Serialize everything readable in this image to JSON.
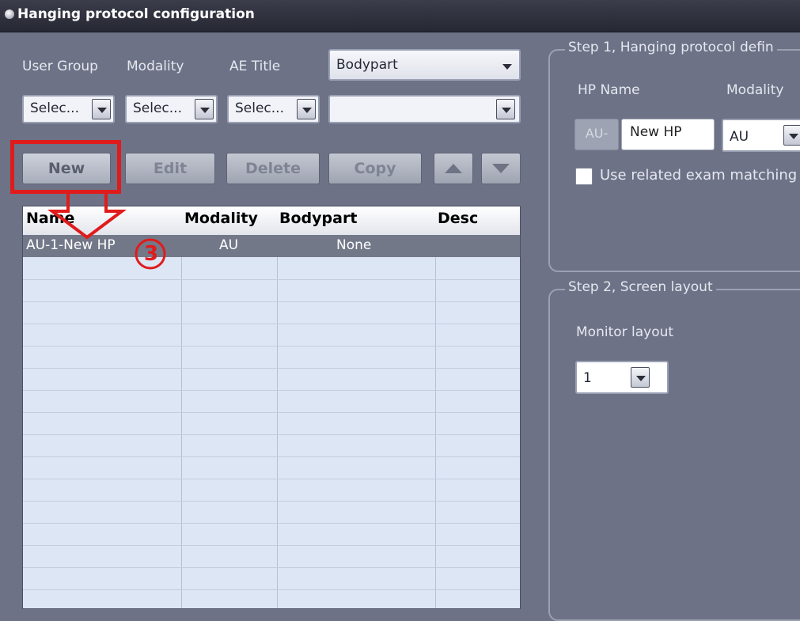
{
  "window": {
    "title": "Hanging protocol configuration"
  },
  "filters": {
    "labels": [
      "User Group",
      "Modality",
      "AE Title"
    ],
    "bodypart_select": "Bodypart",
    "combos": [
      "Selec...",
      "Selec...",
      "Selec...",
      ""
    ]
  },
  "toolbar": {
    "new": "New",
    "edit": "Edit",
    "delete": "Delete",
    "copy": "Copy"
  },
  "table": {
    "columns": [
      "Name",
      "Modality",
      "Bodypart",
      "Desc"
    ],
    "rows": [
      {
        "name": "AU-1-New HP",
        "modality": "AU",
        "bodypart": "None",
        "desc": ""
      }
    ]
  },
  "step1": {
    "title": "Step 1, Hanging protocol defin",
    "hp_name_label": "HP Name",
    "modality_label": "Modality",
    "prefix": "AU-",
    "hp_name_value": "New HP",
    "modality_value": "AU",
    "checkbox_label": "Use related exam matching"
  },
  "step2": {
    "title": "Step 2, Screen layout",
    "monitor_layout_label": "Monitor layout",
    "monitor_layout_value": "1"
  },
  "annotation": {
    "step_number": "3"
  },
  "colors": {
    "background": "#6d7287",
    "highlight": "#e01b1b",
    "selected_row": "#737889",
    "table_bg": "#dce6f5"
  }
}
